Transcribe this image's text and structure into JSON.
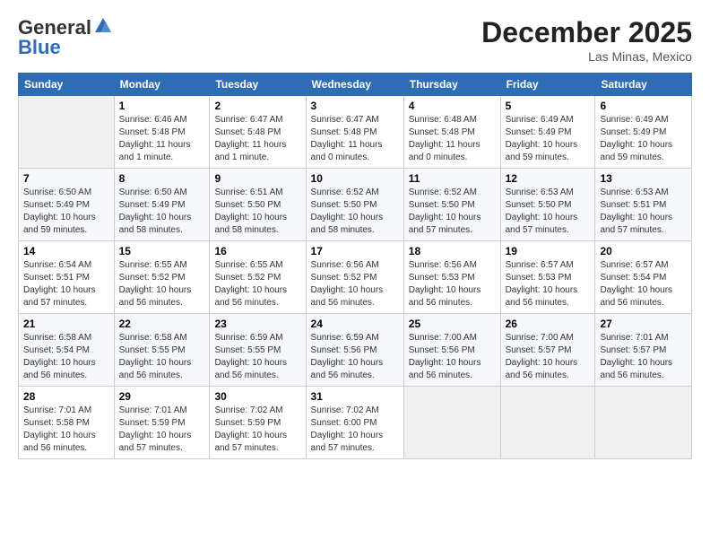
{
  "logo": {
    "general": "General",
    "blue": "Blue"
  },
  "header": {
    "title": "December 2025",
    "subtitle": "Las Minas, Mexico"
  },
  "columns": [
    "Sunday",
    "Monday",
    "Tuesday",
    "Wednesday",
    "Thursday",
    "Friday",
    "Saturday"
  ],
  "weeks": [
    [
      {
        "day": "",
        "info": ""
      },
      {
        "day": "1",
        "info": "Sunrise: 6:46 AM\nSunset: 5:48 PM\nDaylight: 11 hours\nand 1 minute."
      },
      {
        "day": "2",
        "info": "Sunrise: 6:47 AM\nSunset: 5:48 PM\nDaylight: 11 hours\nand 1 minute."
      },
      {
        "day": "3",
        "info": "Sunrise: 6:47 AM\nSunset: 5:48 PM\nDaylight: 11 hours\nand 0 minutes."
      },
      {
        "day": "4",
        "info": "Sunrise: 6:48 AM\nSunset: 5:48 PM\nDaylight: 11 hours\nand 0 minutes."
      },
      {
        "day": "5",
        "info": "Sunrise: 6:49 AM\nSunset: 5:49 PM\nDaylight: 10 hours\nand 59 minutes."
      },
      {
        "day": "6",
        "info": "Sunrise: 6:49 AM\nSunset: 5:49 PM\nDaylight: 10 hours\nand 59 minutes."
      }
    ],
    [
      {
        "day": "7",
        "info": "Sunrise: 6:50 AM\nSunset: 5:49 PM\nDaylight: 10 hours\nand 59 minutes."
      },
      {
        "day": "8",
        "info": "Sunrise: 6:50 AM\nSunset: 5:49 PM\nDaylight: 10 hours\nand 58 minutes."
      },
      {
        "day": "9",
        "info": "Sunrise: 6:51 AM\nSunset: 5:50 PM\nDaylight: 10 hours\nand 58 minutes."
      },
      {
        "day": "10",
        "info": "Sunrise: 6:52 AM\nSunset: 5:50 PM\nDaylight: 10 hours\nand 58 minutes."
      },
      {
        "day": "11",
        "info": "Sunrise: 6:52 AM\nSunset: 5:50 PM\nDaylight: 10 hours\nand 57 minutes."
      },
      {
        "day": "12",
        "info": "Sunrise: 6:53 AM\nSunset: 5:50 PM\nDaylight: 10 hours\nand 57 minutes."
      },
      {
        "day": "13",
        "info": "Sunrise: 6:53 AM\nSunset: 5:51 PM\nDaylight: 10 hours\nand 57 minutes."
      }
    ],
    [
      {
        "day": "14",
        "info": "Sunrise: 6:54 AM\nSunset: 5:51 PM\nDaylight: 10 hours\nand 57 minutes."
      },
      {
        "day": "15",
        "info": "Sunrise: 6:55 AM\nSunset: 5:52 PM\nDaylight: 10 hours\nand 56 minutes."
      },
      {
        "day": "16",
        "info": "Sunrise: 6:55 AM\nSunset: 5:52 PM\nDaylight: 10 hours\nand 56 minutes."
      },
      {
        "day": "17",
        "info": "Sunrise: 6:56 AM\nSunset: 5:52 PM\nDaylight: 10 hours\nand 56 minutes."
      },
      {
        "day": "18",
        "info": "Sunrise: 6:56 AM\nSunset: 5:53 PM\nDaylight: 10 hours\nand 56 minutes."
      },
      {
        "day": "19",
        "info": "Sunrise: 6:57 AM\nSunset: 5:53 PM\nDaylight: 10 hours\nand 56 minutes."
      },
      {
        "day": "20",
        "info": "Sunrise: 6:57 AM\nSunset: 5:54 PM\nDaylight: 10 hours\nand 56 minutes."
      }
    ],
    [
      {
        "day": "21",
        "info": "Sunrise: 6:58 AM\nSunset: 5:54 PM\nDaylight: 10 hours\nand 56 minutes."
      },
      {
        "day": "22",
        "info": "Sunrise: 6:58 AM\nSunset: 5:55 PM\nDaylight: 10 hours\nand 56 minutes."
      },
      {
        "day": "23",
        "info": "Sunrise: 6:59 AM\nSunset: 5:55 PM\nDaylight: 10 hours\nand 56 minutes."
      },
      {
        "day": "24",
        "info": "Sunrise: 6:59 AM\nSunset: 5:56 PM\nDaylight: 10 hours\nand 56 minutes."
      },
      {
        "day": "25",
        "info": "Sunrise: 7:00 AM\nSunset: 5:56 PM\nDaylight: 10 hours\nand 56 minutes."
      },
      {
        "day": "26",
        "info": "Sunrise: 7:00 AM\nSunset: 5:57 PM\nDaylight: 10 hours\nand 56 minutes."
      },
      {
        "day": "27",
        "info": "Sunrise: 7:01 AM\nSunset: 5:57 PM\nDaylight: 10 hours\nand 56 minutes."
      }
    ],
    [
      {
        "day": "28",
        "info": "Sunrise: 7:01 AM\nSunset: 5:58 PM\nDaylight: 10 hours\nand 56 minutes."
      },
      {
        "day": "29",
        "info": "Sunrise: 7:01 AM\nSunset: 5:59 PM\nDaylight: 10 hours\nand 57 minutes."
      },
      {
        "day": "30",
        "info": "Sunrise: 7:02 AM\nSunset: 5:59 PM\nDaylight: 10 hours\nand 57 minutes."
      },
      {
        "day": "31",
        "info": "Sunrise: 7:02 AM\nSunset: 6:00 PM\nDaylight: 10 hours\nand 57 minutes."
      },
      {
        "day": "",
        "info": ""
      },
      {
        "day": "",
        "info": ""
      },
      {
        "day": "",
        "info": ""
      }
    ]
  ]
}
